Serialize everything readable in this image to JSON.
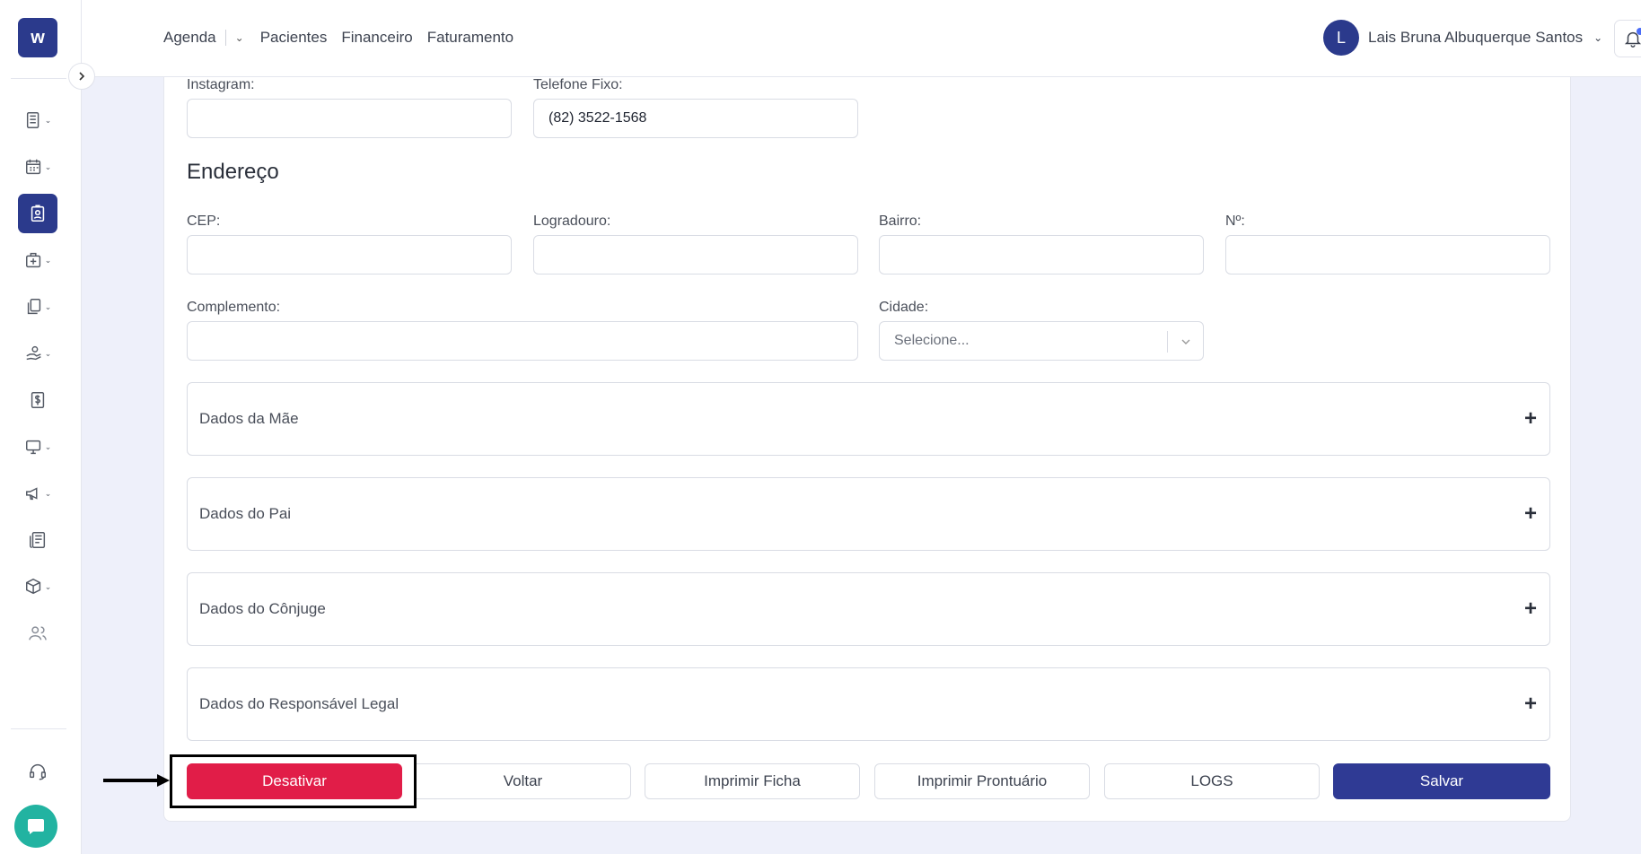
{
  "sidebar": {
    "logo_text": "w",
    "icons": [
      "records-icon",
      "calendar-icon",
      "patient-card-icon",
      "medical-bag-icon",
      "documents-icon",
      "hand-money-icon",
      "dollar-icon",
      "monitor-icon",
      "megaphone-icon",
      "report-icon",
      "package-icon",
      "users-icon",
      "headset-icon"
    ]
  },
  "header": {
    "nav": [
      "Agenda",
      "Pacientes",
      "Financeiro",
      "Faturamento"
    ],
    "user_initial": "L",
    "user_name": "Lais Bruna Albuquerque Santos"
  },
  "form": {
    "instagram_label": "Instagram:",
    "instagram_value": "",
    "telefone_label": "Telefone Fixo:",
    "telefone_value": "(82) 3522-1568",
    "endereco_title": "Endereço",
    "cep_label": "CEP:",
    "logradouro_label": "Logradouro:",
    "bairro_label": "Bairro:",
    "numero_label": "Nº:",
    "complemento_label": "Complemento:",
    "cidade_label": "Cidade:",
    "cidade_placeholder": "Selecione..."
  },
  "accordions": [
    "Dados da Mãe",
    "Dados do Pai",
    "Dados do Cônjuge",
    "Dados do Responsável Legal"
  ],
  "accordion_toggle": "+",
  "buttons": {
    "desativar": "Desativar",
    "voltar": "Voltar",
    "imprimir_ficha": "Imprimir Ficha",
    "imprimir_prontuario": "Imprimir Prontuário",
    "logs": "LOGS",
    "salvar": "Salvar"
  },
  "colors": {
    "brand": "#2b3a8c",
    "danger": "#e11d48",
    "chat": "#22b3a1"
  }
}
